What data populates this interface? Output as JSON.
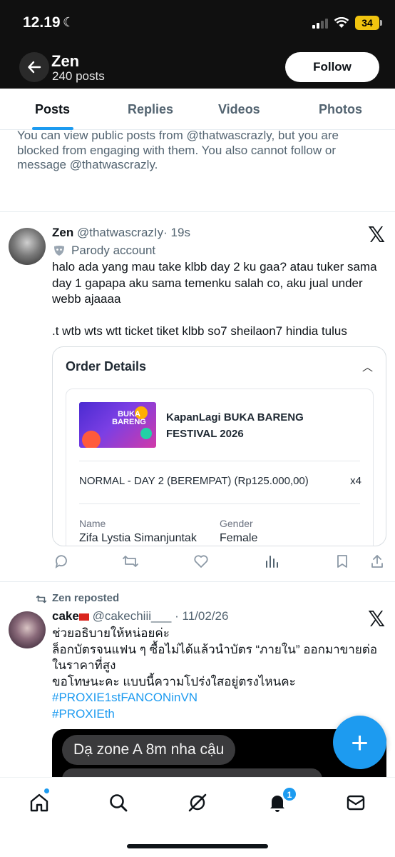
{
  "status_bar": {
    "time": "12.19",
    "battery": "34"
  },
  "profile_header": {
    "name": "Zen",
    "posts_count": "240 posts",
    "follow_label": "Follow"
  },
  "tabs": [
    {
      "label": "Posts",
      "active": true
    },
    {
      "label": "Replies",
      "active": false
    },
    {
      "label": "Videos",
      "active": false
    },
    {
      "label": "Photos",
      "active": false
    }
  ],
  "blocked_notice": "You can view public posts from @thatwascrazly, but you are blocked from engaging with them. You also cannot follow or message @thatwascrazly.",
  "tweet1": {
    "display_name": "Zen",
    "handle": "@thatwascrazIy",
    "time": "· 19s",
    "label": "Parody account",
    "text": "halo ada yang mau take klbb day 2 ku gaa? atau tuker sama day 1 gapapa aku sama temenku salah co, aku jual under webb ajaaaa\n\n.t wtb wts wtt ticket tiket klbb so7 sheilaon7 hindia tulus",
    "card": {
      "title": "Order Details",
      "event_name": "KapanLagi BUKA BARENG FESTIVAL 2026",
      "event_logo_text": "BUKA BARENG",
      "ticket_type": "NORMAL - DAY 2 (BEREMPAT) (Rp125.000,00)",
      "quantity": "x4",
      "name_label": "Name",
      "name_value": "Zifa Lystia Simanjuntak",
      "gender_label": "Gender",
      "gender_value": "Female"
    }
  },
  "tweet2": {
    "repost_label": "Zen reposted",
    "display_name": "cake",
    "handle": "@cakechiii___",
    "time": "· 11/02/26",
    "lines": [
      "ช่วยอธิบายให้หน่อยค่ะ",
      "ล็อกบัตรจนแฟน ๆ ซื้อไม่ได้แล้วนำบัตร “ภายใน” ออกมาขายต่อในราคาที่สูง",
      "ขอโทษนะคะ แบบนี้ความโปร่งใสอยู่ตรงไหนคะ"
    ],
    "hashtags": [
      "#PROXIE1stFANCONinVN",
      "#PROXIEth"
    ],
    "media_bubble": "Dạ zone A 8m nha cậu"
  },
  "fab_label": "+",
  "bottom_nav": {
    "notification_badge": "1"
  },
  "colors": {
    "accent": "#1d9bf0",
    "header_bg": "#101010",
    "muted": "#536471"
  }
}
